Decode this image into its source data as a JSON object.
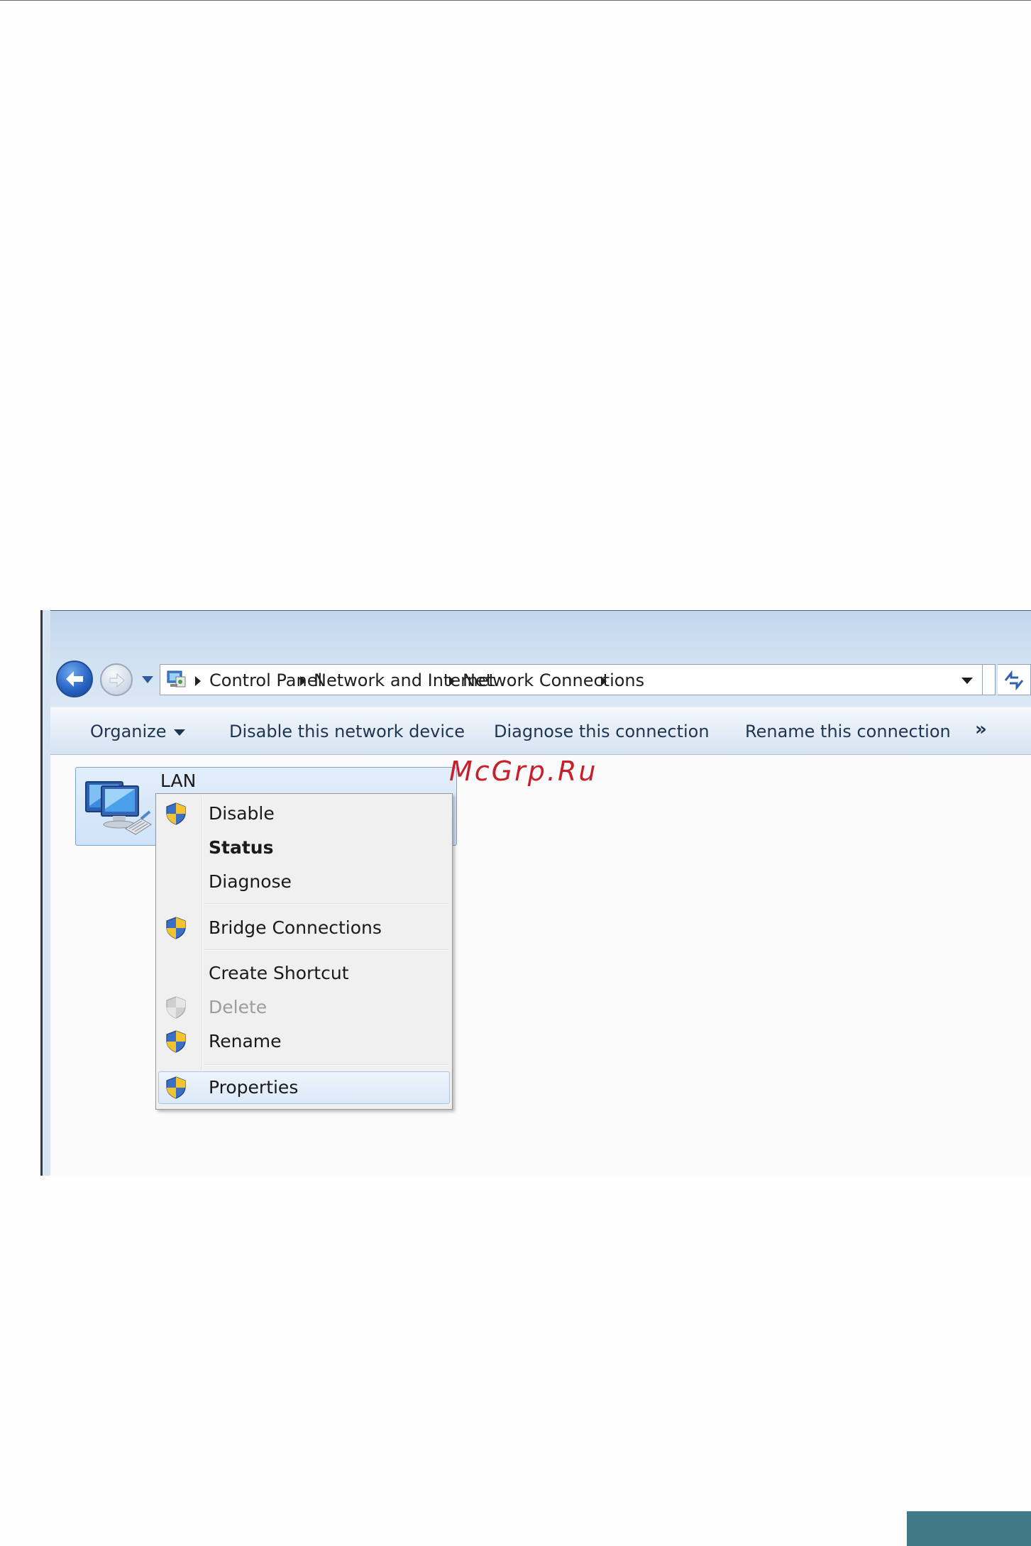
{
  "address_bar": {
    "crumbs": [
      "Control Panel",
      "Network and Internet",
      "Network Connections"
    ]
  },
  "toolbar": {
    "organize": "Organize",
    "disable": "Disable this network device",
    "diagnose": "Diagnose this connection",
    "rename": "Rename this connection",
    "more": "»"
  },
  "connection": {
    "label": "LAN"
  },
  "watermark": "McGrp.Ru",
  "context_menu": {
    "items": [
      {
        "label": "Disable",
        "icon": "uac-shield-icon"
      },
      {
        "label": "Status",
        "default": true
      },
      {
        "label": "Diagnose"
      },
      {
        "label": "Bridge Connections",
        "icon": "uac-shield-icon"
      },
      {
        "label": "Create Shortcut"
      },
      {
        "label": "Delete",
        "icon": "uac-shield-icon",
        "disabled": true
      },
      {
        "label": "Rename",
        "icon": "uac-shield-icon"
      },
      {
        "label": "Properties",
        "icon": "uac-shield-icon",
        "hovered": true
      }
    ]
  },
  "colors": {
    "titlebar": "#c2d6ec",
    "toolbar_text": "#1f3550",
    "menu_bg": "#f0f0f0",
    "watermark": "#c7202b",
    "corner_tab": "#3f7a86"
  }
}
